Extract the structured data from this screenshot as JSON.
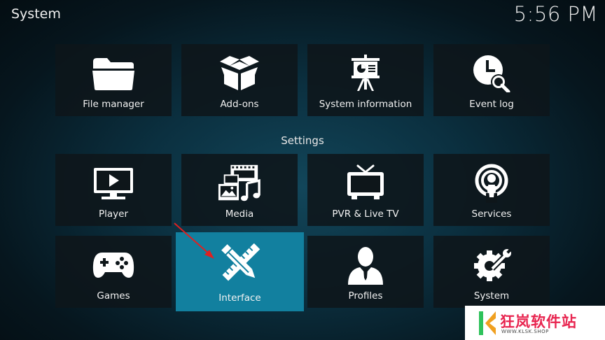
{
  "header": {
    "title": "System",
    "clock": "5:56 PM"
  },
  "top_row": [
    {
      "label": "File manager",
      "icon": "folder-icon"
    },
    {
      "label": "Add-ons",
      "icon": "open-box-icon"
    },
    {
      "label": "System information",
      "icon": "presentation-board-icon"
    },
    {
      "label": "Event log",
      "icon": "clock-search-icon"
    }
  ],
  "settings": {
    "title": "Settings",
    "items": [
      {
        "label": "Player",
        "icon": "tv-play-icon"
      },
      {
        "label": "Media",
        "icon": "media-filmstrip-music-icon"
      },
      {
        "label": "PVR & Live TV",
        "icon": "tv-antenna-icon"
      },
      {
        "label": "Services",
        "icon": "podcast-broadcast-icon"
      },
      {
        "label": "Games",
        "icon": "gamepad-icon"
      },
      {
        "label": "Interface",
        "icon": "pencil-ruler-icon",
        "focused": true
      },
      {
        "label": "Profiles",
        "icon": "user-silhouette-icon"
      },
      {
        "label": "System",
        "icon": "gear-wrench-icon"
      }
    ]
  },
  "colors": {
    "focus_accent": "#12809f",
    "annotation_arrow": "#e02020",
    "watermark_text": "#e8244f"
  },
  "watermark": {
    "text": "狂岚软件站",
    "subtext": "WWW.KLSK.SHOP"
  }
}
